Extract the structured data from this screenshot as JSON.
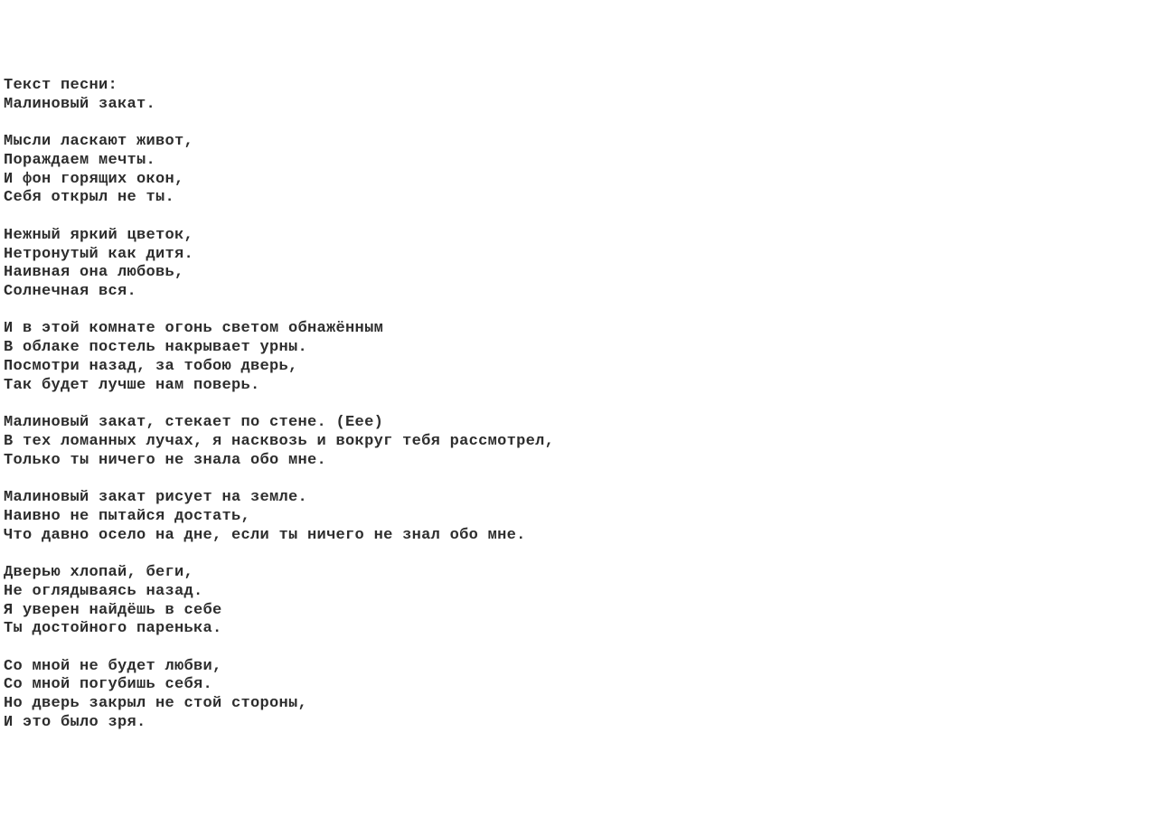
{
  "header": {
    "label": "Текст песни:",
    "title": "Малиновый закат."
  },
  "stanzas": [
    [
      "Мысли ласкают живот,",
      "Пораждаем мечты.",
      "И фон горящих окон,",
      "Себя открыл не ты."
    ],
    [
      "Нежный яркий цветок,",
      "Нетронутый как дитя.",
      "Наивная она любовь,",
      "Солнечная вся."
    ],
    [
      "И в этой комнате огонь светом обнажённым",
      "В облаке постель накрывает урны.",
      "Посмотри назад, за тобою дверь,",
      "Так будет лучше нам поверь."
    ],
    [
      "Малиновый закат, стекает по стене. (Еее)",
      "В тех ломанных лучах, я насквозь и вокруг тебя рассмотрел,",
      "Только ты ничего не знала обо мне."
    ],
    [
      "Малиновый закат рисует на земле.",
      "Наивно не пытайся достать,",
      "Что давно осело на дне, если ты ничего не знал обо мне."
    ],
    [
      "Дверью хлопай, беги,",
      "Не оглядываясь назад.",
      "Я уверен найдёшь в себе",
      "Ты достойного паренька."
    ],
    [
      "Со мной не будет любви,",
      "Со мной погубишь себя.",
      "Но дверь закрыл не стой стороны,",
      "И это было зря."
    ]
  ]
}
